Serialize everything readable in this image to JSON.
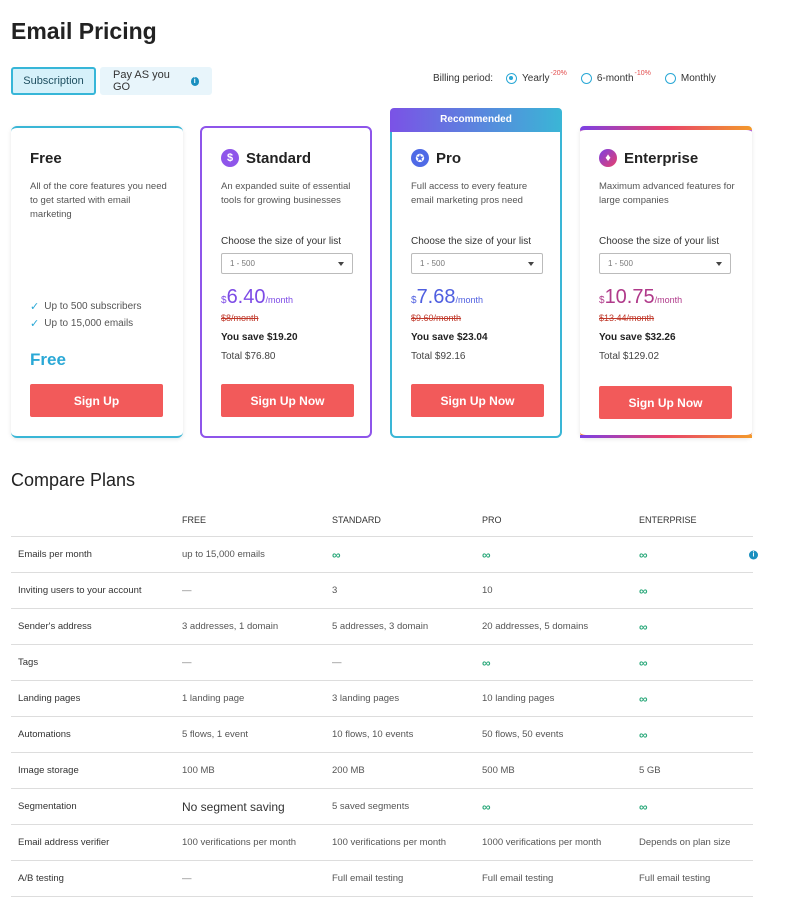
{
  "page": {
    "title": "Email Pricing"
  },
  "mode_tabs": {
    "subscription": "Subscription",
    "payg": "Pay AS you GO"
  },
  "billing": {
    "label": "Billing period:",
    "options": [
      {
        "label": "Yearly",
        "discount": "-20%",
        "selected": true
      },
      {
        "label": "6-month",
        "discount": "-10%",
        "selected": false
      },
      {
        "label": "Monthly",
        "discount": "",
        "selected": false
      }
    ]
  },
  "plans": {
    "free": {
      "name": "Free",
      "description": "All of the core features you need to get started with email marketing",
      "features": [
        "Up to 500 subscribers",
        "Up to 15,000 emails"
      ],
      "price_label": "Free",
      "cta": "Sign Up"
    },
    "standard": {
      "name": "Standard",
      "icon": "$",
      "description": "An expanded suite of essential tools for growing businesses",
      "size_label": "Choose the size of your list",
      "size_value": "1 - 500",
      "currency": "$",
      "price": "6.40",
      "per": "/month",
      "old_price": "$8/month",
      "save": "You save $19.20",
      "total": "Total $76.80",
      "cta": "Sign Up Now"
    },
    "pro": {
      "badge": "Recommended",
      "name": "Pro",
      "icon": "✪",
      "description": "Full access to every feature email marketing pros need",
      "size_label": "Choose the size of your list",
      "size_value": "1 - 500",
      "currency": "$",
      "price": "7.68",
      "per": "/month",
      "old_price": "$9.60/month",
      "save": "You save $23.04",
      "total": "Total $92.16",
      "cta": "Sign Up Now"
    },
    "enterprise": {
      "name": "Enterprise",
      "icon": "♦",
      "description": "Maximum advanced features for large companies",
      "size_label": "Choose the size of your list",
      "size_value": "1 - 500",
      "currency": "$",
      "price": "10.75",
      "per": "/month",
      "old_price": "$13.44/month",
      "save": "You save $32.26",
      "total": "Total $129.02",
      "cta": "Sign Up Now"
    }
  },
  "compare": {
    "title": "Compare Plans",
    "headers": [
      "",
      "FREE",
      "STANDARD",
      "PRO",
      "ENTERPRISE"
    ],
    "rows": [
      {
        "label": "Emails per month",
        "free": "up to 15,000 emails",
        "std": "∞",
        "pro": "∞",
        "ent": "∞"
      },
      {
        "label": "Inviting users to your account",
        "free": "—",
        "std": "3",
        "pro": "10",
        "ent": "∞"
      },
      {
        "label": "Sender's address",
        "free": "3 addresses, 1 domain",
        "std": "5 addresses, 3 domain",
        "pro": "20 addresses, 5 domains",
        "ent": "∞"
      },
      {
        "label": "Tags",
        "free": "—",
        "std": "—",
        "pro": "∞",
        "ent": "∞"
      },
      {
        "label": "Landing pages",
        "free": "1 landing page",
        "std": "3 landing pages",
        "pro": "10 landing pages",
        "ent": "∞"
      },
      {
        "label": "Automations",
        "free": "5 flows, 1 event",
        "std": "10 flows, 10 events",
        "pro": "50 flows, 50 events",
        "ent": "∞"
      },
      {
        "label": "Image storage",
        "free": "100 MB",
        "std": "200 MB",
        "pro": "500 MB",
        "ent": "5 GB"
      },
      {
        "label": "Segmentation",
        "free": "No segment saving",
        "std": "5 saved segments",
        "pro": "∞",
        "ent": "∞"
      },
      {
        "label": "Email address verifier",
        "free": "100 verifications per month",
        "std": "100 verifications per month",
        "pro": "1000 verifications per month",
        "ent": "Depends on plan size"
      },
      {
        "label": "A/B testing",
        "free": "—",
        "std": "Full email testing",
        "pro": "Full email testing",
        "ent": "Full email testing"
      }
    ]
  },
  "colors": {
    "accent": "#2aa8d6",
    "cta": "#f25a5a",
    "standard": "#8e55ea",
    "pro": "#4f6ae6",
    "enterprise": "#b03a8a",
    "infinity": "#2aa87a"
  }
}
